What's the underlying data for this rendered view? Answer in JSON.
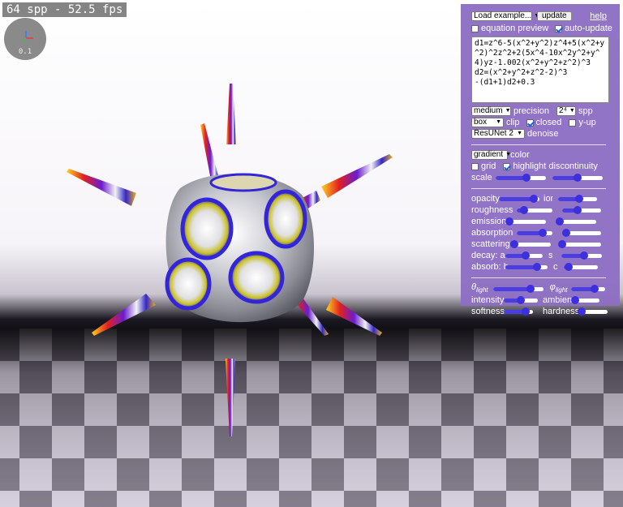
{
  "hud": {
    "fps_text": "64 spp - 52.5 fps",
    "gizmo_scale": "0.1"
  },
  "panel": {
    "example_select": "Load example...",
    "update_label": "update",
    "help_label": "help",
    "equation_preview": {
      "label": "equation preview",
      "checked": false
    },
    "auto_update": {
      "label": "auto-update",
      "checked": true
    },
    "equation_lines": [
      "d1=z^6-5(x^2+y^2)z^4+5(x^2+y",
      "^2)^2z^2+2(5x^4-10x^2y^2+y^",
      "4)yz-1.002(x^2+y^2+z^2)^3",
      "d2=(x^2+y^2+z^2-2)^3",
      "-(d1+1)d2+0.3"
    ],
    "precision": {
      "value": "medium",
      "label": "precision"
    },
    "spp": {
      "value": "2⁴",
      "label": "spp"
    },
    "clip": {
      "value": "box",
      "label": "clip"
    },
    "closed": {
      "label": "closed",
      "checked": true
    },
    "y_up": {
      "label": "y-up",
      "checked": false
    },
    "denoise": {
      "value": "ResUNet 2",
      "label": "denoise"
    },
    "color": {
      "value": "gradient",
      "label": "color"
    },
    "grid": {
      "label": "grid",
      "checked": false
    },
    "highlight": {
      "label": "highlight discontinuity",
      "checked": true
    },
    "scale": {
      "label": "scale",
      "a": 0.62,
      "b": 0.5
    },
    "material": {
      "opacity_label": "opacity",
      "opacity": 0.85,
      "ior_label": "ior",
      "ior": 0.55,
      "roughness_label": "roughness",
      "roughness": 0.2,
      "roughness2": 0.4,
      "emission_label": "emission",
      "emission": 0.03,
      "emission2": 0.1,
      "absorption_label": "absorption",
      "absorption": 0.72,
      "absorption2": 0.1,
      "scattering_label": "scattering",
      "scattering": 0.03,
      "scattering2": 0.03,
      "decay_label": "decay: a",
      "decay_a": 0.55,
      "decay_s_label": "s",
      "decay_s": 0.55,
      "absorb_label": "absorb: h",
      "absorb_h": 0.75,
      "absorb_c_label": "c",
      "absorb_c": 0.15
    },
    "light": {
      "theta_label": "θ",
      "theta_sub": "light",
      "theta": 0.75,
      "phi_label": "φ",
      "phi_sub": "light",
      "phi": 0.7,
      "intensity_label": "intensity",
      "intensity": 0.5,
      "ambient_label": "ambient",
      "ambient": 0.05,
      "softness_label": "softness",
      "softness": 0.75,
      "hardness_label": "hardness",
      "hardness": 0.05
    }
  },
  "colors": {
    "panel_bg": "#8e6ec4",
    "slider_fill": "#4a3ee0",
    "slider_thumb": "#3b2fe0"
  }
}
